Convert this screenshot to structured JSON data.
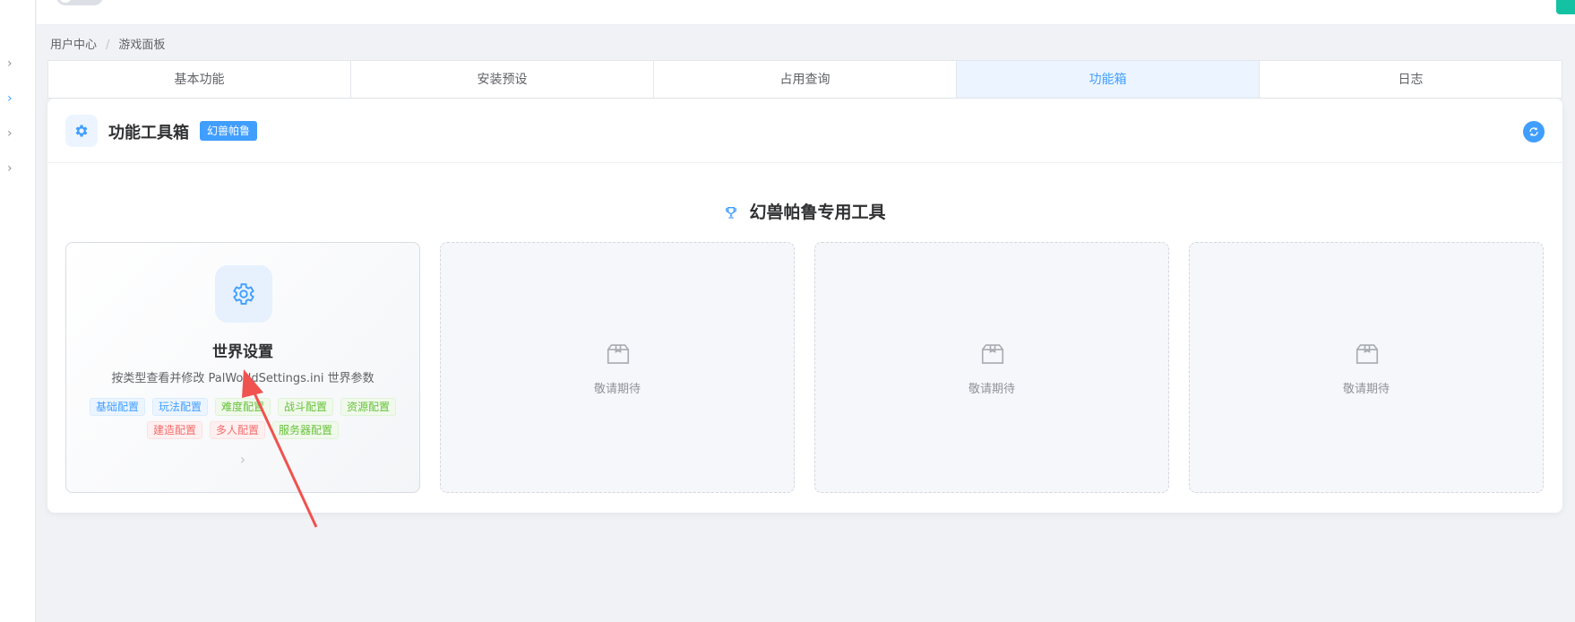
{
  "breadcrumb": {
    "items": [
      "用户中心",
      "游戏面板"
    ],
    "separator": "/"
  },
  "tabs": [
    {
      "label": "基本功能",
      "active": false
    },
    {
      "label": "安装预设",
      "active": false
    },
    {
      "label": "占用查询",
      "active": false
    },
    {
      "label": "功能箱",
      "active": true
    },
    {
      "label": "日志",
      "active": false
    }
  ],
  "panel": {
    "title": "功能工具箱",
    "badge": "幻兽帕鲁",
    "section_title": "幻兽帕鲁专用工具",
    "main_card": {
      "icon": "gear-icon",
      "title": "世界设置",
      "description": "按类型查看并修改 PalWorldSettings.ini 世界参数",
      "tags_row1": [
        "基础配置",
        "玩法配置",
        "难度配置",
        "战斗配置",
        "资源配置"
      ],
      "tags_row2": [
        "建造配置",
        "多人配置",
        "服务器配置"
      ]
    },
    "placeholder_label": "敬请期待"
  },
  "colors": {
    "accent": "#409eff",
    "active_tab_bg": "#ecf5ff",
    "annotation_arrow": "#f0524f",
    "top_button": "#13c2a3"
  }
}
